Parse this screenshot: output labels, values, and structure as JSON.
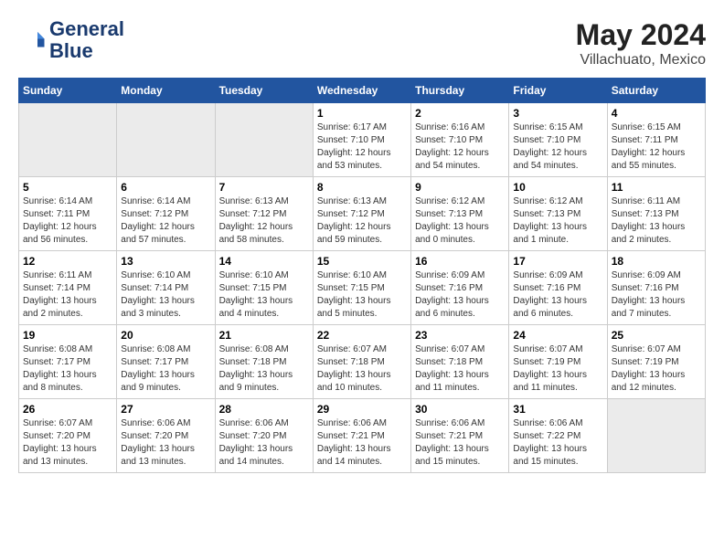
{
  "header": {
    "logo_line1": "General",
    "logo_line2": "Blue",
    "month_year": "May 2024",
    "location": "Villachuato, Mexico"
  },
  "weekdays": [
    "Sunday",
    "Monday",
    "Tuesday",
    "Wednesday",
    "Thursday",
    "Friday",
    "Saturday"
  ],
  "weeks": [
    [
      {
        "day": "",
        "empty": true
      },
      {
        "day": "",
        "empty": true
      },
      {
        "day": "",
        "empty": true
      },
      {
        "day": "1",
        "sunrise": "6:17 AM",
        "sunset": "7:10 PM",
        "daylight": "12 hours and 53 minutes."
      },
      {
        "day": "2",
        "sunrise": "6:16 AM",
        "sunset": "7:10 PM",
        "daylight": "12 hours and 54 minutes."
      },
      {
        "day": "3",
        "sunrise": "6:15 AM",
        "sunset": "7:10 PM",
        "daylight": "12 hours and 54 minutes."
      },
      {
        "day": "4",
        "sunrise": "6:15 AM",
        "sunset": "7:11 PM",
        "daylight": "12 hours and 55 minutes."
      }
    ],
    [
      {
        "day": "5",
        "sunrise": "6:14 AM",
        "sunset": "7:11 PM",
        "daylight": "12 hours and 56 minutes."
      },
      {
        "day": "6",
        "sunrise": "6:14 AM",
        "sunset": "7:12 PM",
        "daylight": "12 hours and 57 minutes."
      },
      {
        "day": "7",
        "sunrise": "6:13 AM",
        "sunset": "7:12 PM",
        "daylight": "12 hours and 58 minutes."
      },
      {
        "day": "8",
        "sunrise": "6:13 AM",
        "sunset": "7:12 PM",
        "daylight": "12 hours and 59 minutes."
      },
      {
        "day": "9",
        "sunrise": "6:12 AM",
        "sunset": "7:13 PM",
        "daylight": "13 hours and 0 minutes."
      },
      {
        "day": "10",
        "sunrise": "6:12 AM",
        "sunset": "7:13 PM",
        "daylight": "13 hours and 1 minute."
      },
      {
        "day": "11",
        "sunrise": "6:11 AM",
        "sunset": "7:13 PM",
        "daylight": "13 hours and 2 minutes."
      }
    ],
    [
      {
        "day": "12",
        "sunrise": "6:11 AM",
        "sunset": "7:14 PM",
        "daylight": "13 hours and 2 minutes."
      },
      {
        "day": "13",
        "sunrise": "6:10 AM",
        "sunset": "7:14 PM",
        "daylight": "13 hours and 3 minutes."
      },
      {
        "day": "14",
        "sunrise": "6:10 AM",
        "sunset": "7:15 PM",
        "daylight": "13 hours and 4 minutes."
      },
      {
        "day": "15",
        "sunrise": "6:10 AM",
        "sunset": "7:15 PM",
        "daylight": "13 hours and 5 minutes."
      },
      {
        "day": "16",
        "sunrise": "6:09 AM",
        "sunset": "7:16 PM",
        "daylight": "13 hours and 6 minutes."
      },
      {
        "day": "17",
        "sunrise": "6:09 AM",
        "sunset": "7:16 PM",
        "daylight": "13 hours and 6 minutes."
      },
      {
        "day": "18",
        "sunrise": "6:09 AM",
        "sunset": "7:16 PM",
        "daylight": "13 hours and 7 minutes."
      }
    ],
    [
      {
        "day": "19",
        "sunrise": "6:08 AM",
        "sunset": "7:17 PM",
        "daylight": "13 hours and 8 minutes."
      },
      {
        "day": "20",
        "sunrise": "6:08 AM",
        "sunset": "7:17 PM",
        "daylight": "13 hours and 9 minutes."
      },
      {
        "day": "21",
        "sunrise": "6:08 AM",
        "sunset": "7:18 PM",
        "daylight": "13 hours and 9 minutes."
      },
      {
        "day": "22",
        "sunrise": "6:07 AM",
        "sunset": "7:18 PM",
        "daylight": "13 hours and 10 minutes."
      },
      {
        "day": "23",
        "sunrise": "6:07 AM",
        "sunset": "7:18 PM",
        "daylight": "13 hours and 11 minutes."
      },
      {
        "day": "24",
        "sunrise": "6:07 AM",
        "sunset": "7:19 PM",
        "daylight": "13 hours and 11 minutes."
      },
      {
        "day": "25",
        "sunrise": "6:07 AM",
        "sunset": "7:19 PM",
        "daylight": "13 hours and 12 minutes."
      }
    ],
    [
      {
        "day": "26",
        "sunrise": "6:07 AM",
        "sunset": "7:20 PM",
        "daylight": "13 hours and 13 minutes."
      },
      {
        "day": "27",
        "sunrise": "6:06 AM",
        "sunset": "7:20 PM",
        "daylight": "13 hours and 13 minutes."
      },
      {
        "day": "28",
        "sunrise": "6:06 AM",
        "sunset": "7:20 PM",
        "daylight": "13 hours and 14 minutes."
      },
      {
        "day": "29",
        "sunrise": "6:06 AM",
        "sunset": "7:21 PM",
        "daylight": "13 hours and 14 minutes."
      },
      {
        "day": "30",
        "sunrise": "6:06 AM",
        "sunset": "7:21 PM",
        "daylight": "13 hours and 15 minutes."
      },
      {
        "day": "31",
        "sunrise": "6:06 AM",
        "sunset": "7:22 PM",
        "daylight": "13 hours and 15 minutes."
      },
      {
        "day": "",
        "empty": true
      }
    ]
  ],
  "labels": {
    "sunrise": "Sunrise:",
    "sunset": "Sunset:",
    "daylight": "Daylight:"
  }
}
